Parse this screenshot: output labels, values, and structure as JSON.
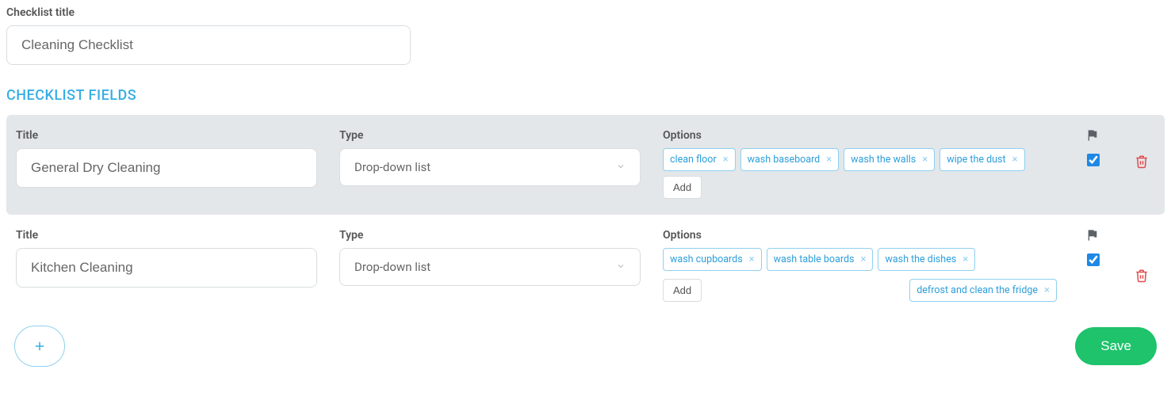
{
  "checklist_title_label": "Checklist title",
  "checklist_title_value": "Cleaning Checklist",
  "section_heading": "CHECKLIST FIELDS",
  "col_labels": {
    "title": "Title",
    "type": "Type",
    "options": "Options"
  },
  "add_label": "Add",
  "save_label": "Save",
  "rows": [
    {
      "title": "General Dry Cleaning",
      "type": "Drop-down list",
      "tags": [
        "clean floor",
        "wash baseboard",
        "wash the walls",
        "wipe the dust"
      ],
      "flagged": true,
      "checked": true,
      "active": true
    },
    {
      "title": "Kitchen Cleaning",
      "type": "Drop-down list",
      "tags_line1": [
        "wash cupboards",
        "wash table boards",
        "wash the dishes"
      ],
      "tags_line2": [
        "defrost and clean the fridge"
      ],
      "flagged": true,
      "checked": true,
      "active": false
    }
  ]
}
